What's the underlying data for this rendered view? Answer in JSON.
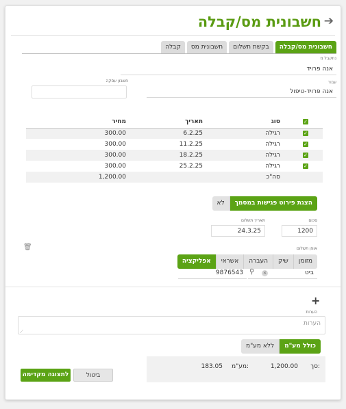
{
  "header": {
    "title": "חשבונית מס/קבלה"
  },
  "tabs": [
    {
      "label": "חשבונית מס/קבלה",
      "active": true
    },
    {
      "label": "בקשת תשלום",
      "active": false
    },
    {
      "label": "חשבונית מס",
      "active": false
    },
    {
      "label": "קבלה",
      "active": false
    }
  ],
  "customer": {
    "label": "נתקבל מ",
    "value": "אנה פרויד",
    "for_label": "עבור",
    "for_value": "אנה פרויד-טיפול",
    "account_label": "חשבון עסקה"
  },
  "table": {
    "headers": {
      "type": "סוג",
      "date": "תאריך",
      "price": "מחיר"
    },
    "rows": [
      {
        "type": "רגילה",
        "date": "6.2.25",
        "price": "300.00"
      },
      {
        "type": "רגילה",
        "date": "11.2.25",
        "price": "300.00"
      },
      {
        "type": "רגילה",
        "date": "18.2.25",
        "price": "300.00"
      },
      {
        "type": "רגילה",
        "date": "25.2.25",
        "price": "300.00"
      }
    ],
    "total_label": "סה\"כ",
    "total_value": "1,200.00"
  },
  "show_details": {
    "on_label": "הצגת פירוט פגישות במסמך",
    "off_label": "לא"
  },
  "payment": {
    "amount_label": "סכום",
    "amount_value": "1200",
    "date_label": "תאריך תשלום",
    "date_value": "24.3.25",
    "method_label": "אופן תשלום",
    "methods": [
      {
        "label": "מזומן",
        "active": false
      },
      {
        "label": "שיק",
        "active": false
      },
      {
        "label": "העברה",
        "active": false
      },
      {
        "label": "אשראי",
        "active": false
      },
      {
        "label": "אפליקציה",
        "active": true
      }
    ],
    "app_value": "ביט",
    "ref_value": "9876543"
  },
  "notes": {
    "label": "הערות",
    "placeholder": "הערות"
  },
  "vat": {
    "with_label": "כולל מע\"מ",
    "without_label": "ללא מע\"מ"
  },
  "summary": {
    "total_label": "סך:",
    "total_value": "1,200.00",
    "vat_label": "מע\"מ:",
    "vat_value": "183.05"
  },
  "actions": {
    "cancel_label": "ביטול",
    "preview_label": "לתצוגה מקדימה"
  },
  "icons": {
    "back": "arrow-right-icon",
    "trash": "trash-icon",
    "search": "search-icon",
    "clear": "clear-icon",
    "plus": "plus-icon",
    "resize": "resize-handle-icon"
  },
  "colors": {
    "accent": "#5ba315",
    "title": "#5a9b12"
  }
}
